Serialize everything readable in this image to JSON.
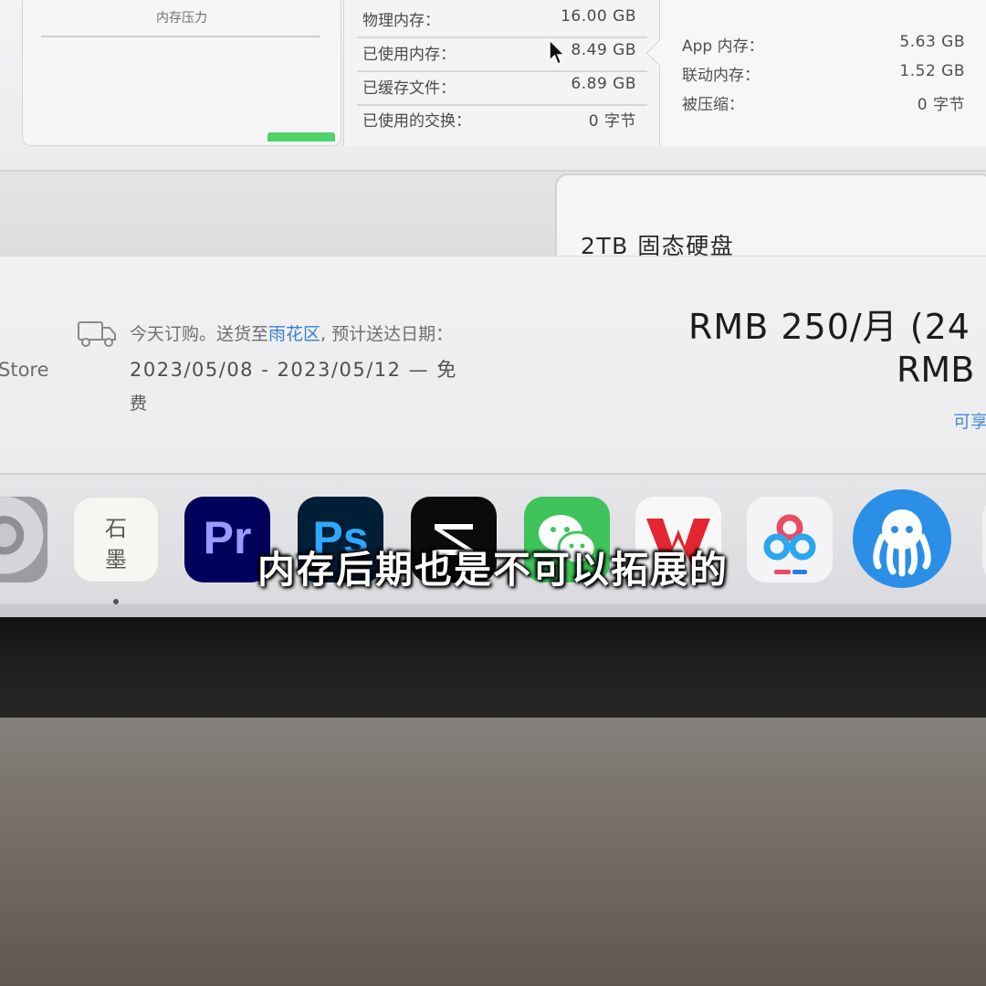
{
  "memory_panel": {
    "pressure_title": "内存压力",
    "stats": [
      {
        "label": "物理内存：",
        "value": "16.00 GB"
      },
      {
        "label": "已使用内存：",
        "value": "8.49 GB"
      },
      {
        "label": "已缓存文件：",
        "value": "6.89 GB"
      },
      {
        "label": "已使用的交换：",
        "value": "0 字节"
      }
    ],
    "breakdown": [
      {
        "label": "App 内存：",
        "value": "5.63 GB"
      },
      {
        "label": "联动内存：",
        "value": "1.52 GB"
      },
      {
        "label": "被压缩：",
        "value": "0 字节"
      }
    ]
  },
  "storage_option": "2TB 固态硬盘",
  "order": {
    "store_label": "Store",
    "ship_prefix": "今天订购。送货至",
    "ship_location": "雨花区",
    "ship_suffix": ", 预计送达日期：",
    "delivery_dates": "2023/05/08 - 2023/05/12 — 免",
    "delivery_tail": "费",
    "price_main": "RMB 250/月 (24",
    "price_sub": "RMB",
    "price_link": "可享"
  },
  "dock": {
    "shimo_top": "石",
    "shimo_bottom": "墨",
    "pr_label": "Pr",
    "ps_label": "Ps"
  },
  "colors": {
    "accent_link": "#3a7fd0",
    "pressure_green": "#4fd46b"
  },
  "subtitle": "内存后期也是不可以拓展的"
}
